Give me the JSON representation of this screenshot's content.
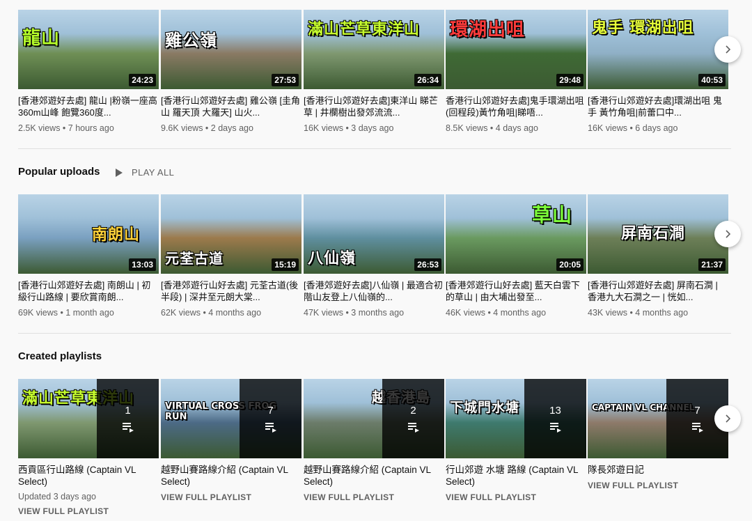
{
  "recent_videos": [
    {
      "thumb_text": "龍山",
      "title": "[香港郊遊好去處] 龍山 |粉嶺一座高360m山峰 飽覽360度...",
      "meta": "2.5K views • 7 hours ago",
      "duration": "24:23",
      "bg": "#6f8f55",
      "fg": "#b6ff2a"
    },
    {
      "thumb_text": "雞公嶺",
      "title": "[香港行山郊遊好去處] 雞公嶺 [圭角山 羅天頂 大羅天] 山火...",
      "meta": "9.6K views • 2 days ago",
      "duration": "27:53",
      "bg": "#8a7a64",
      "fg": "#ffffff"
    },
    {
      "thumb_text": "滿山芒草東洋山",
      "title": "[香港行山郊遊好去處]東洋山 睇芒草 | 井欄樹出發郊流流...",
      "meta": "16K views • 3 days ago",
      "duration": "26:34",
      "bg": "#7f9870",
      "fg": "#c8ff2e"
    },
    {
      "thumb_text": "環湖出咀",
      "title": "香港行山郊遊好去處]鬼手環湖出咀(回程段)黃竹角咀|睇唔...",
      "meta": "8.5K views • 4 days ago",
      "duration": "29:48",
      "bg": "#3f6a35",
      "fg": "#ff3b3b"
    },
    {
      "thumb_text": "鬼手 環湖出咀",
      "title": "[香港行山郊遊好去處]環湖出咀 鬼手 黃竹角咀|前蕾口中...",
      "meta": "16K views • 6 days ago",
      "duration": "40:53",
      "bg": "#8fb0c6",
      "fg": "#e8ff3a"
    }
  ],
  "popular": {
    "heading": "Popular uploads",
    "play_all": "PLAY ALL",
    "videos": [
      {
        "thumb_text": "南朗山",
        "title": "[香港行山郊遊好去處] 南朗山 | 初級行山路線 | 要欣賞南朗...",
        "meta": "69K views • 1 month ago",
        "duration": "13:03",
        "bg": "#7aa0c0",
        "fg": "#ffd23a"
      },
      {
        "thumb_text": "元荃古道",
        "title": "[香港郊遊行山好去處] 元荃古道(後半段) | 深井至元朗大棠...",
        "meta": "62K views • 4 months ago",
        "duration": "15:19",
        "bg": "#9c7a4c",
        "fg": "#ffffff"
      },
      {
        "thumb_text": "八仙嶺",
        "title": "[香港郊遊好去處]八仙嶺 | 最適合初階山友登上八仙嶺的...",
        "meta": "47K views • 3 months ago",
        "duration": "26:53",
        "bg": "#5f8f9f",
        "fg": "#ffffff"
      },
      {
        "thumb_text": "草山",
        "title": "[香港郊遊行山好去處] 藍天白雲下的草山 | 由大埔出發至...",
        "meta": "46K views • 4 months ago",
        "duration": "20:05",
        "bg": "#6a9a60",
        "fg": "#7dff3a"
      },
      {
        "thumb_text": "屏南石澗",
        "title": "[香港行山郊遊好去處] 屏南石澗 | 香港九大石澗之一 | 恍如...",
        "meta": "43K views • 4 months ago",
        "duration": "21:37",
        "bg": "#6d7f58",
        "fg": "#ffffff"
      }
    ]
  },
  "playlists": {
    "heading": "Created playlists",
    "items": [
      {
        "thumb_text": "滿山芒草東洋山",
        "count": "1",
        "title": "西貢區行山路線 (Captain VL Select)",
        "updated": "Updated 3 days ago",
        "link": "VIEW FULL PLAYLIST",
        "bg": "#7f9870",
        "fg": "#c8ff2e"
      },
      {
        "thumb_text": "VIRTUAL CROSS FROG RUN",
        "count": "7",
        "title": "越野山賽路線介紹 (Captain VL Select)",
        "updated": "",
        "link": "VIEW FULL PLAYLIST",
        "bg": "#4c6a86",
        "fg": "#ffffff"
      },
      {
        "thumb_text": "越香港島",
        "count": "2",
        "title": "越野山賽路線介紹 (Captain VL Select)",
        "updated": "",
        "link": "VIEW FULL PLAYLIST",
        "bg": "#6c7c6a",
        "fg": "#ffffff"
      },
      {
        "thumb_text": "下城門水塘",
        "count": "13",
        "title": "行山郊遊 水塘 路線 (Captain VL Select)",
        "updated": "",
        "link": "VIEW FULL PLAYLIST",
        "bg": "#3e7a6e",
        "fg": "#ffffff"
      },
      {
        "thumb_text": "CAPTAIN VL CHANNEL",
        "count": "7",
        "title": "隊長郊遊日記",
        "updated": "",
        "link": "VIEW FULL PLAYLIST",
        "bg": "#8e7a6a",
        "fg": "#ffffff"
      }
    ]
  }
}
